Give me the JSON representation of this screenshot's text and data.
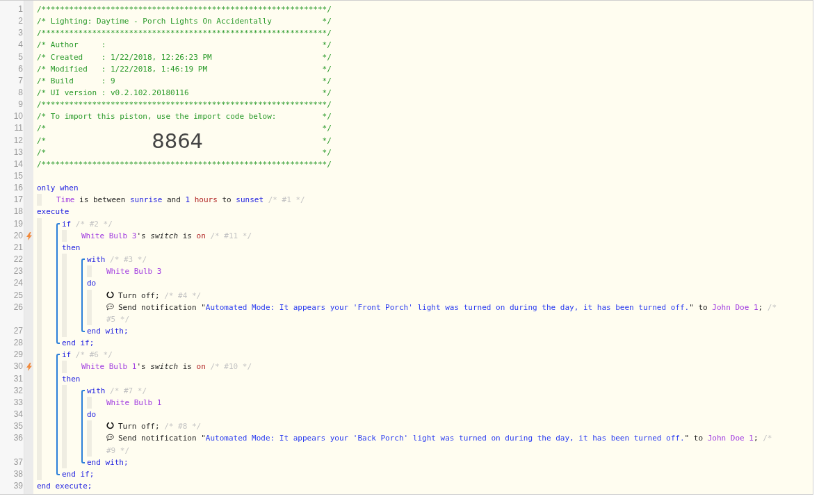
{
  "header_lines": [
    {
      "number": "1",
      "kind": "rule",
      "left": "/**************************************************************/"
    },
    {
      "number": "2",
      "kind": "comment",
      "left": "/* Lighting: Daytime - Porch Lights On Accidentally",
      "right": "*/"
    },
    {
      "number": "3",
      "kind": "rule",
      "left": "/**************************************************************/"
    },
    {
      "number": "4",
      "kind": "comment",
      "left": "/* Author     :",
      "right": "*/"
    },
    {
      "number": "5",
      "kind": "comment",
      "left": "/* Created    : 1/22/2018, 12:26:23 PM",
      "right": "*/"
    },
    {
      "number": "6",
      "kind": "comment",
      "left": "/* Modified   : 1/22/2018, 1:46:19 PM",
      "right": "*/"
    },
    {
      "number": "7",
      "kind": "comment",
      "left": "/* Build      : 9",
      "right": "*/"
    },
    {
      "number": "8",
      "kind": "comment",
      "left": "/* UI version : v0.2.102.20180116",
      "right": "*/"
    },
    {
      "number": "9",
      "kind": "rule",
      "left": "/**************************************************************/"
    },
    {
      "number": "10",
      "kind": "comment",
      "left": "/* To import this piston, use the import code below:",
      "right": "*/"
    },
    {
      "number": "11",
      "kind": "comment",
      "left": "/*",
      "right": "*/"
    },
    {
      "number": "12",
      "kind": "import-code",
      "left": "/*",
      "code": "8864",
      "right": "*/"
    },
    {
      "number": "13",
      "kind": "comment",
      "left": "/*",
      "right": "*/"
    },
    {
      "number": "14",
      "kind": "rule",
      "left": "/**************************************************************/"
    },
    {
      "number": "15",
      "kind": "blank"
    }
  ],
  "program": [
    {
      "kind": "line",
      "number": "16",
      "trigger": false,
      "tokens": [
        {
          "t": "only when",
          "kind": "keyword"
        }
      ],
      "children": [
        {
          "kind": "line",
          "number": "17",
          "trigger": false,
          "tokens": [
            {
              "t": "Time",
              "kind": "device"
            },
            {
              "t": " is between ",
              "kind": "plain"
            },
            {
              "t": "sunrise",
              "kind": "keyword"
            },
            {
              "t": " and ",
              "kind": "plain"
            },
            {
              "t": "1 ",
              "kind": "keyword"
            },
            {
              "t": "hours",
              "kind": "value"
            },
            {
              "t": " to ",
              "kind": "plain"
            },
            {
              "t": "sunset",
              "kind": "keyword"
            },
            {
              "t": " /* #1 */",
              "kind": "comment"
            }
          ]
        }
      ]
    },
    {
      "kind": "line",
      "number": "18",
      "trigger": false,
      "tokens": [
        {
          "t": "execute",
          "kind": "keyword"
        }
      ],
      "children": [
        {
          "kind": "block",
          "items": [
            {
              "kind": "line",
              "number": "19",
              "trigger": false,
              "tokens": [
                {
                  "t": "if",
                  "kind": "keyword"
                },
                {
                  "t": " /* #2 */",
                  "kind": "comment"
                }
              ],
              "children": [
                {
                  "kind": "line",
                  "number": "20",
                  "trigger": true,
                  "tokens": [
                    {
                      "t": "White Bulb 3",
                      "kind": "device"
                    },
                    {
                      "t": "'s ",
                      "kind": "plain"
                    },
                    {
                      "t": "switch",
                      "kind": "attribute"
                    },
                    {
                      "t": " is ",
                      "kind": "plain"
                    },
                    {
                      "t": "on",
                      "kind": "value"
                    },
                    {
                      "t": " /* #11 */",
                      "kind": "comment"
                    }
                  ]
                }
              ]
            },
            {
              "kind": "line",
              "number": "21",
              "trigger": false,
              "tokens": [
                {
                  "t": "then",
                  "kind": "keyword"
                }
              ],
              "children": [
                {
                  "kind": "block",
                  "items": [
                    {
                      "kind": "line",
                      "number": "22",
                      "trigger": false,
                      "tokens": [
                        {
                          "t": "with",
                          "kind": "keyword"
                        },
                        {
                          "t": " /* #3 */",
                          "kind": "comment"
                        }
                      ],
                      "children": [
                        {
                          "kind": "line",
                          "number": "23",
                          "trigger": false,
                          "tokens": [
                            {
                              "t": "White Bulb 3",
                              "kind": "device"
                            }
                          ]
                        }
                      ]
                    },
                    {
                      "kind": "line",
                      "number": "24",
                      "trigger": false,
                      "tokens": [
                        {
                          "t": "do",
                          "kind": "keyword"
                        }
                      ],
                      "children": [
                        {
                          "kind": "command",
                          "number": "25",
                          "trigger": false,
                          "tokens": [
                            {
                              "t": "Turn off;",
                              "kind": "plain"
                            },
                            {
                              "t": " /* #4 */",
                              "kind": "comment"
                            }
                          ]
                        },
                        {
                          "kind": "notification",
                          "number": "26",
                          "trigger": false,
                          "tokens": [
                            {
                              "t": "Send notification \"",
                              "kind": "plain"
                            },
                            {
                              "t": "Automated Mode: It appears your 'Front Porch' light was turned on during the day, it has been turned off.",
                              "kind": "string"
                            },
                            {
                              "t": "\" to ",
                              "kind": "plain"
                            },
                            {
                              "t": "John Doe 1",
                              "kind": "device"
                            },
                            {
                              "t": "; ",
                              "kind": "plain"
                            },
                            {
                              "t": "/*",
                              "kind": "comment"
                            }
                          ],
                          "continuation": [
                            {
                              "t": "#5 */",
                              "kind": "comment"
                            }
                          ]
                        }
                      ]
                    },
                    {
                      "kind": "line",
                      "number": "27",
                      "trigger": false,
                      "tokens": [
                        {
                          "t": "end with;",
                          "kind": "keyword"
                        }
                      ]
                    }
                  ]
                }
              ]
            },
            {
              "kind": "line",
              "number": "28",
              "trigger": false,
              "tokens": [
                {
                  "t": "end if;",
                  "kind": "keyword"
                }
              ]
            }
          ]
        },
        {
          "kind": "block",
          "items": [
            {
              "kind": "line",
              "number": "29",
              "trigger": false,
              "tokens": [
                {
                  "t": "if",
                  "kind": "keyword"
                },
                {
                  "t": " /* #6 */",
                  "kind": "comment"
                }
              ],
              "children": [
                {
                  "kind": "line",
                  "number": "30",
                  "trigger": true,
                  "tokens": [
                    {
                      "t": "White Bulb 1",
                      "kind": "device"
                    },
                    {
                      "t": "'s ",
                      "kind": "plain"
                    },
                    {
                      "t": "switch",
                      "kind": "attribute"
                    },
                    {
                      "t": " is ",
                      "kind": "plain"
                    },
                    {
                      "t": "on",
                      "kind": "value"
                    },
                    {
                      "t": " /* #10 */",
                      "kind": "comment"
                    }
                  ]
                }
              ]
            },
            {
              "kind": "line",
              "number": "31",
              "trigger": false,
              "tokens": [
                {
                  "t": "then",
                  "kind": "keyword"
                }
              ],
              "children": [
                {
                  "kind": "block",
                  "items": [
                    {
                      "kind": "line",
                      "number": "32",
                      "trigger": false,
                      "tokens": [
                        {
                          "t": "with",
                          "kind": "keyword"
                        },
                        {
                          "t": " /* #7 */",
                          "kind": "comment"
                        }
                      ],
                      "children": [
                        {
                          "kind": "line",
                          "number": "33",
                          "trigger": false,
                          "tokens": [
                            {
                              "t": "White Bulb 1",
                              "kind": "device"
                            }
                          ]
                        }
                      ]
                    },
                    {
                      "kind": "line",
                      "number": "34",
                      "trigger": false,
                      "tokens": [
                        {
                          "t": "do",
                          "kind": "keyword"
                        }
                      ],
                      "children": [
                        {
                          "kind": "command",
                          "number": "35",
                          "trigger": false,
                          "tokens": [
                            {
                              "t": "Turn off;",
                              "kind": "plain"
                            },
                            {
                              "t": " /* #8 */",
                              "kind": "comment"
                            }
                          ]
                        },
                        {
                          "kind": "notification",
                          "number": "36",
                          "trigger": false,
                          "tokens": [
                            {
                              "t": "Send notification \"",
                              "kind": "plain"
                            },
                            {
                              "t": "Automated Mode: It appears your 'Back Porch' light was turned on during the day, it has been turned off.",
                              "kind": "string"
                            },
                            {
                              "t": "\" to ",
                              "kind": "plain"
                            },
                            {
                              "t": "John Doe 1",
                              "kind": "device"
                            },
                            {
                              "t": "; ",
                              "kind": "plain"
                            },
                            {
                              "t": "/*",
                              "kind": "comment"
                            }
                          ],
                          "continuation": [
                            {
                              "t": "#9 */",
                              "kind": "comment"
                            }
                          ]
                        }
                      ]
                    },
                    {
                      "kind": "line",
                      "number": "37",
                      "trigger": false,
                      "tokens": [
                        {
                          "t": "end with;",
                          "kind": "keyword"
                        }
                      ]
                    }
                  ]
                }
              ]
            },
            {
              "kind": "line",
              "number": "38",
              "trigger": false,
              "tokens": [
                {
                  "t": "end if;",
                  "kind": "keyword"
                }
              ]
            }
          ]
        }
      ]
    },
    {
      "kind": "line",
      "number": "39",
      "trigger": false,
      "tokens": [
        {
          "t": "end execute;",
          "kind": "keyword"
        }
      ]
    }
  ]
}
